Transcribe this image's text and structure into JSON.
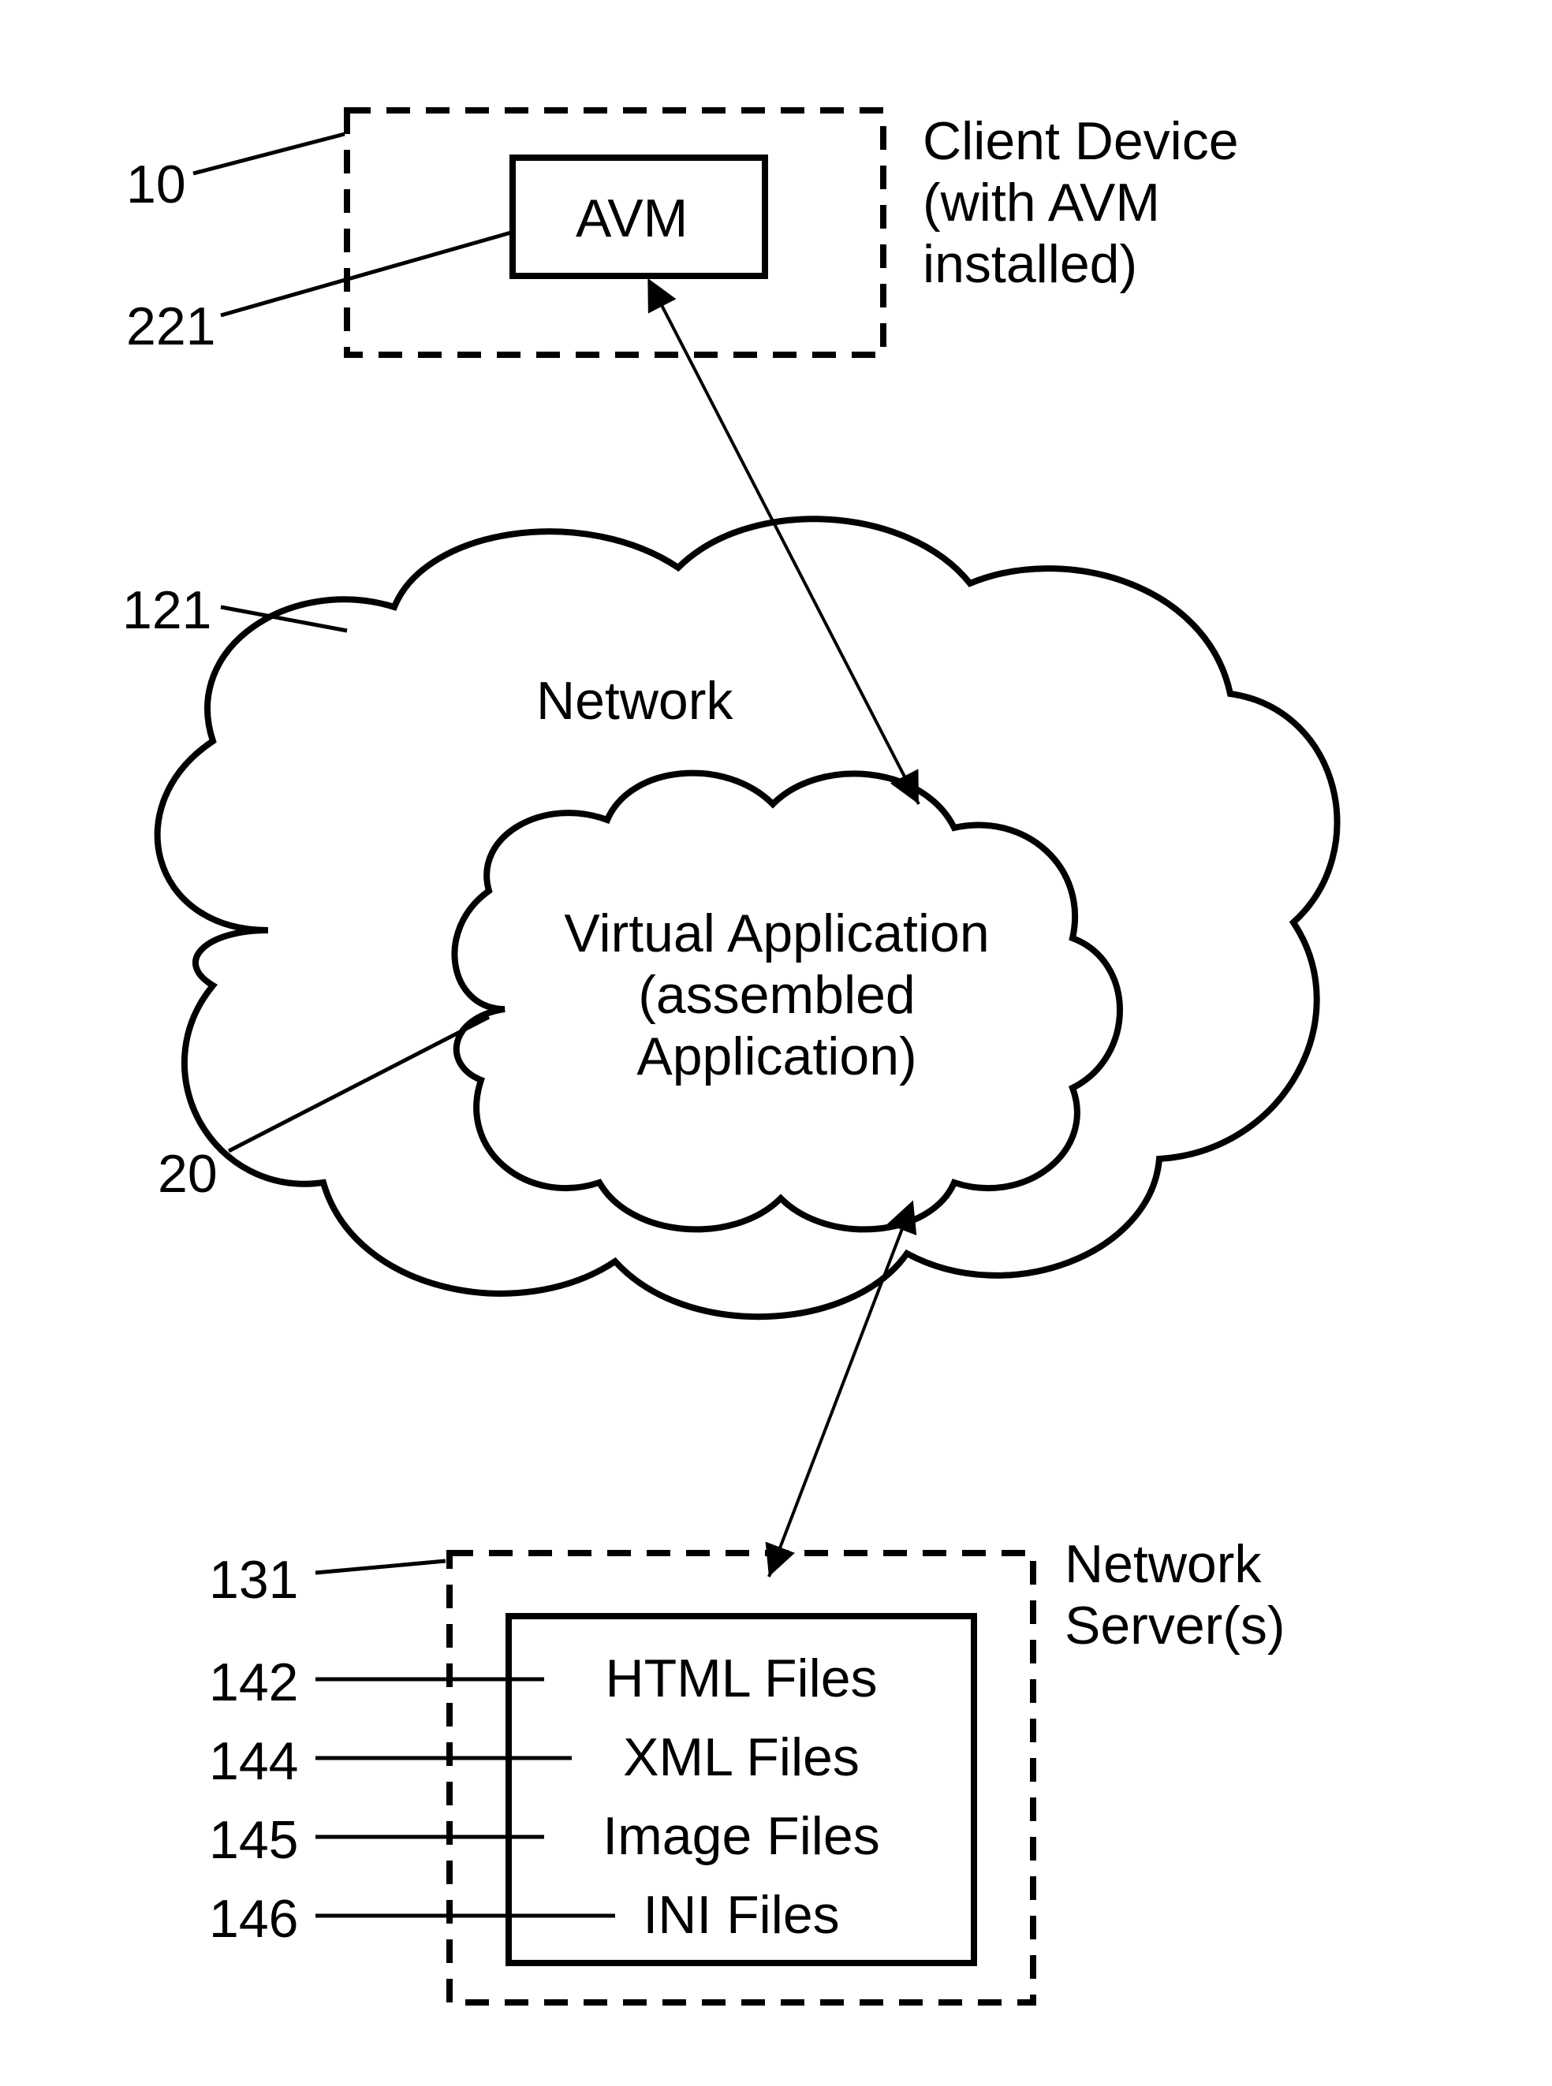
{
  "client_device": {
    "title_line1": "Client Device",
    "title_line2": "(with AVM",
    "title_line3": "installed)",
    "avm_label": "AVM",
    "ref_client": "10",
    "ref_avm": "221"
  },
  "network": {
    "label": "Network",
    "ref": "121",
    "virtual_app_line1": "Virtual Application",
    "virtual_app_line2": "(assembled",
    "virtual_app_line3": "Application)",
    "ref_vapp": "20"
  },
  "server": {
    "title_line1": "Network",
    "title_line2": "Server(s)",
    "ref_server": "131",
    "files": {
      "html": "HTML Files",
      "xml": "XML Files",
      "image": "Image Files",
      "ini": "INI Files"
    },
    "refs": {
      "html": "142",
      "xml": "144",
      "image": "145",
      "ini": "146"
    }
  }
}
